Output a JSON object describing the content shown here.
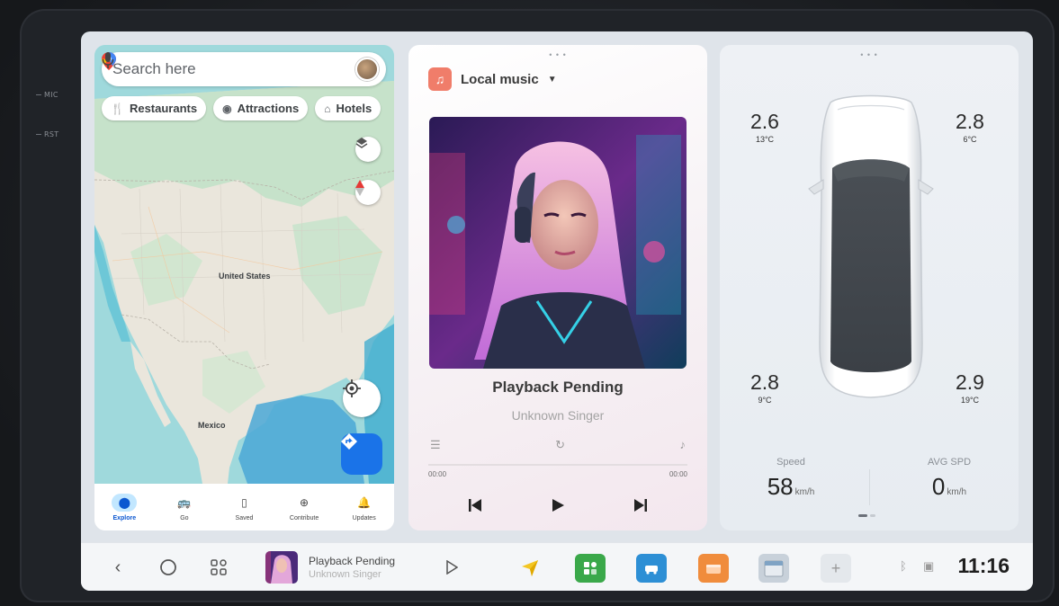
{
  "device": {
    "side_labels": [
      "MIC",
      "RST"
    ]
  },
  "map": {
    "search_placeholder": "Search here",
    "chips": [
      {
        "icon": "fork-knife-icon",
        "label": "Restaurants"
      },
      {
        "icon": "camera-icon",
        "label": "Attractions"
      },
      {
        "icon": "bed-icon",
        "label": "Hotels"
      }
    ],
    "labels": {
      "country": "United States",
      "country2": "Mexico"
    },
    "nav": [
      {
        "icon": "location-pin-icon",
        "label": "Explore",
        "active": true
      },
      {
        "icon": "bus-icon",
        "label": "Go",
        "active": false
      },
      {
        "icon": "bookmark-icon",
        "label": "Saved",
        "active": false
      },
      {
        "icon": "add-circle-icon",
        "label": "Contribute",
        "active": false
      },
      {
        "icon": "bell-icon",
        "label": "Updates",
        "active": false
      }
    ]
  },
  "music": {
    "source_label": "Local music",
    "track_title": "Playback Pending",
    "artist": "Unknown Singer",
    "elapsed": "00:00",
    "duration": "00:00",
    "progress": 0
  },
  "car": {
    "tires": {
      "front_left": {
        "pressure": "2.6",
        "temp": "13°C"
      },
      "front_right": {
        "pressure": "2.8",
        "temp": "6°C"
      },
      "rear_left": {
        "pressure": "2.8",
        "temp": "9°C"
      },
      "rear_right": {
        "pressure": "2.9",
        "temp": "19°C"
      }
    },
    "speed_label": "Speed",
    "speed_value": "58",
    "speed_unit": "km/h",
    "avg_label": "AVG SPD",
    "avg_value": "0",
    "avg_unit": "km/h"
  },
  "dock": {
    "now_title": "Playback Pending",
    "now_artist": "Unknown Singer",
    "clock": "11:16",
    "apps": [
      {
        "name": "navigation-app-icon",
        "color": "#f3c623"
      },
      {
        "name": "green-app-icon",
        "color": "#3aa84a"
      },
      {
        "name": "car-app-icon",
        "color": "#2d8fd5"
      },
      {
        "name": "orange-app-icon",
        "color": "#f08c3c"
      },
      {
        "name": "calendar-app-icon",
        "color": "#c8d1da"
      }
    ]
  }
}
